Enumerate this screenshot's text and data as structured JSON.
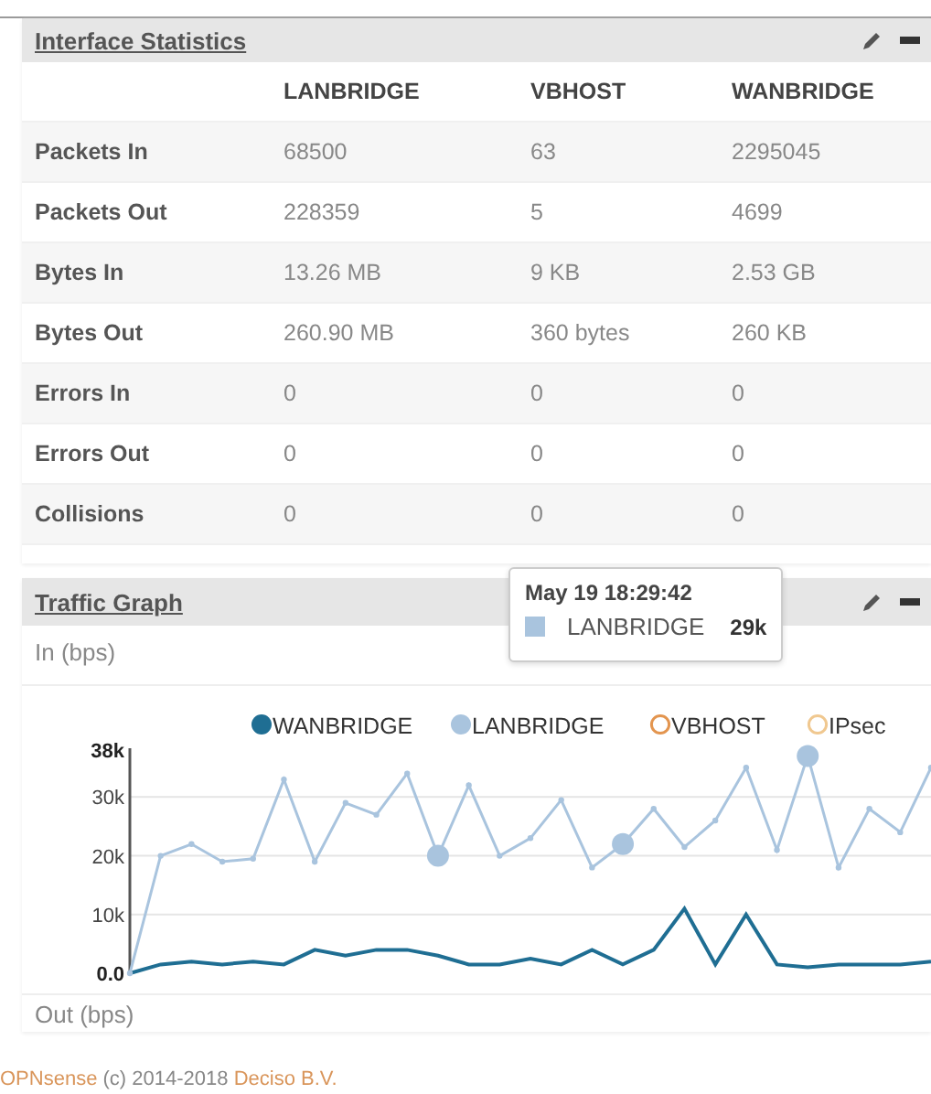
{
  "interface_statistics": {
    "title": "Interface Statistics",
    "columns": [
      "LANBRIDGE",
      "VBHOST",
      "WANBRIDGE"
    ],
    "rows": [
      {
        "label": "Packets In",
        "values": [
          "68500",
          "63",
          "2295045"
        ]
      },
      {
        "label": "Packets Out",
        "values": [
          "228359",
          "5",
          "4699"
        ]
      },
      {
        "label": "Bytes In",
        "values": [
          "13.26 MB",
          "9 KB",
          "2.53 GB"
        ]
      },
      {
        "label": "Bytes Out",
        "values": [
          "260.90 MB",
          "360 bytes",
          "260 KB"
        ]
      },
      {
        "label": "Errors In",
        "values": [
          "0",
          "0",
          "0"
        ]
      },
      {
        "label": "Errors Out",
        "values": [
          "0",
          "0",
          "0"
        ]
      },
      {
        "label": "Collisions",
        "values": [
          "0",
          "0",
          "0"
        ]
      }
    ]
  },
  "traffic_graph": {
    "title": "Traffic Graph",
    "in_label": "In (bps)",
    "out_label": "Out (bps)",
    "tooltip": {
      "time": "May 19 18:29:42",
      "series": "LANBRIDGE",
      "value": "29k",
      "color": "#a9c4de"
    },
    "marked_points": [
      false,
      false,
      false,
      false,
      false,
      false,
      false,
      false,
      false,
      false,
      true,
      false,
      false,
      false,
      false,
      false,
      true,
      false,
      false,
      false,
      false,
      false,
      true,
      false,
      false,
      false,
      false
    ],
    "chart_data": {
      "type": "line",
      "ylim": [
        0,
        38000
      ],
      "grid": true,
      "legend": "top",
      "yticks": [
        {
          "value": 0,
          "label": "0.0"
        },
        {
          "value": 10000,
          "label": "10k"
        },
        {
          "value": 20000,
          "label": "20k"
        },
        {
          "value": 30000,
          "label": "30k"
        },
        {
          "value": 38000,
          "label": "38k"
        }
      ],
      "series": [
        {
          "name": "WANBRIDGE",
          "color": "#1f6e93",
          "values": [
            0,
            1500,
            2000,
            1500,
            2000,
            1500,
            4000,
            3000,
            4000,
            4000,
            3000,
            1500,
            1500,
            2500,
            1500,
            4000,
            1500,
            4000,
            11000,
            1500,
            10000,
            1500,
            1000,
            1500,
            1500,
            1500,
            2000
          ]
        },
        {
          "name": "LANBRIDGE",
          "color": "#a9c4de",
          "marker": "circle",
          "values": [
            0,
            20000,
            22000,
            19000,
            19500,
            33000,
            19000,
            29000,
            27000,
            34000,
            20000,
            32000,
            20000,
            23000,
            29500,
            18000,
            22000,
            28000,
            21500,
            26000,
            35000,
            21000,
            37000,
            18000,
            28000,
            24000,
            35000
          ]
        },
        {
          "name": "VBHOST",
          "color": "#e3954f",
          "values": [
            null,
            null,
            null,
            null,
            null,
            null,
            null,
            null,
            null,
            null,
            null,
            null,
            null,
            null,
            null,
            null,
            null,
            null,
            null,
            null,
            null,
            null,
            null,
            null,
            null,
            null,
            null
          ]
        },
        {
          "name": "IPsec",
          "color": "#f0c890",
          "values": [
            null,
            null,
            null,
            null,
            null,
            null,
            null,
            null,
            null,
            null,
            null,
            null,
            null,
            null,
            null,
            null,
            null,
            null,
            null,
            null,
            null,
            null,
            null,
            null,
            null,
            null,
            null
          ]
        }
      ]
    }
  },
  "footer": {
    "brand": "OPNsense",
    "text": "(c) 2014-2018",
    "company": "Deciso B.V."
  }
}
